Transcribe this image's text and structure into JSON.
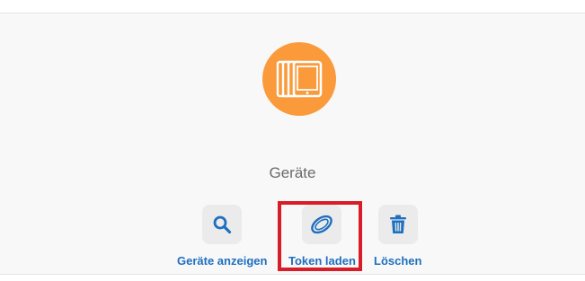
{
  "section": {
    "title": "Geräte",
    "icon": "tablet-devices-icon",
    "icon_color": "#fb9a3b"
  },
  "actions": [
    {
      "label": "Geräte anzeigen",
      "icon": "search-icon"
    },
    {
      "label": "Token laden",
      "icon": "coin-icon"
    },
    {
      "label": "Löschen",
      "icon": "trash-icon"
    }
  ],
  "colors": {
    "accent": "#1f6fbf",
    "highlight": "#d81d28",
    "panel_bg": "#f8f8f8",
    "tile_bg": "#ebebeb"
  }
}
